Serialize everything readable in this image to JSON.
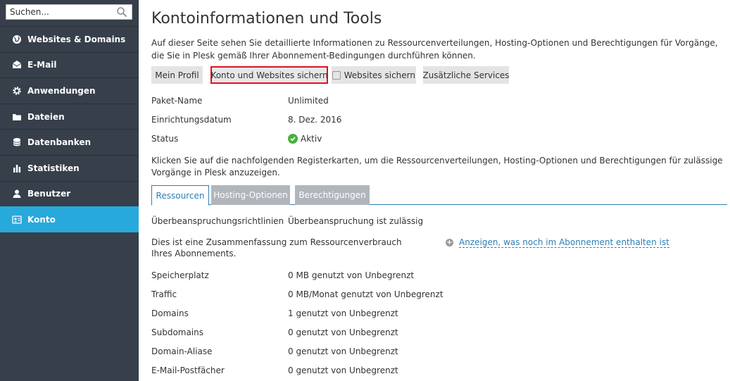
{
  "search": {
    "placeholder": "Suchen..."
  },
  "sidebar": {
    "items": [
      {
        "label": "Websites & Domains",
        "icon": "globe-icon"
      },
      {
        "label": "E-Mail",
        "icon": "envelope-icon"
      },
      {
        "label": "Anwendungen",
        "icon": "gear-icon"
      },
      {
        "label": "Dateien",
        "icon": "folder-icon"
      },
      {
        "label": "Datenbanken",
        "icon": "database-icon"
      },
      {
        "label": "Statistiken",
        "icon": "bar-chart-icon"
      },
      {
        "label": "Benutzer",
        "icon": "user-icon"
      },
      {
        "label": "Konto",
        "icon": "account-icon",
        "active": true
      }
    ]
  },
  "page": {
    "title": "Kontoinformationen und Tools",
    "intro": "Auf dieser Seite sehen Sie detaillierte Informationen zu Ressourcenverteilungen, Hosting-Optionen und Berechtigungen für Vorgänge, die Sie in Plesk gemäß Ihrer Abonnement-Bedingungen durchführen können.",
    "buttons": {
      "profile": "Mein Profil",
      "backup_all": "Konto und Websites sichern",
      "backup_sites": "Websites sichern",
      "services": "Zusätzliche Services"
    },
    "info": {
      "package_label": "Paket-Name",
      "package_value": "Unlimited",
      "setup_label": "Einrichtungsdatum",
      "setup_value": "8. Dez. 2016",
      "status_label": "Status",
      "status_value": "Aktiv"
    },
    "tabs_hint": "Klicken Sie auf die nachfolgenden Registerkarten, um die Ressourcenverteilungen, Hosting-Optionen und Berechtigungen für zulässige Vorgänge in Plesk anzuzeigen.",
    "tabs": {
      "resources": "Ressourcen",
      "hosting": "Hosting-Optionen",
      "permissions": "Berechtigungen"
    },
    "overuse_label": "Überbeanspruchungsrichtlinien",
    "overuse_value": "Überbeanspruchung ist zulässig",
    "summary": "Dies ist eine Zusammenfassung zum Ressourcenverbrauch Ihres Abonnements.",
    "show_more": "Anzeigen, was noch im Abonnement enthalten ist",
    "resources": [
      {
        "label": "Speicherplatz",
        "value": "0 MB genutzt von Unbegrenzt"
      },
      {
        "label": "Traffic",
        "value": "0 MB/Monat genutzt von Unbegrenzt"
      },
      {
        "label": "Domains",
        "value": "1 genutzt von Unbegrenzt"
      },
      {
        "label": "Subdomains",
        "value": "0 genutzt von Unbegrenzt"
      },
      {
        "label": "Domain-Aliase",
        "value": "0 genutzt von Unbegrenzt"
      },
      {
        "label": "E-Mail-Postfächer",
        "value": "0 genutzt von Unbegrenzt"
      }
    ]
  },
  "colors": {
    "sidebar_bg": "#363f4a",
    "active_nav": "#28a9db",
    "highlight_border": "#e3101e",
    "link": "#2b7fb3",
    "status_ok": "#47b03a"
  }
}
